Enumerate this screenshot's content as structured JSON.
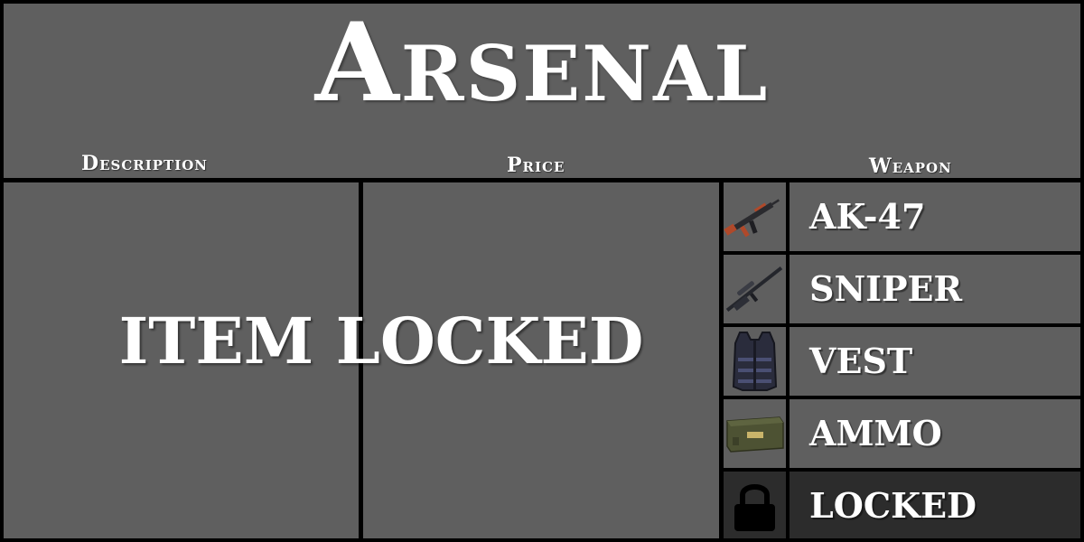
{
  "title": "Arsenal",
  "columns": {
    "description": "Description",
    "price": "Price",
    "weapon": "Weapon"
  },
  "status_text": "ITEM LOCKED",
  "weapons": [
    {
      "label": "AK-47",
      "icon": "ak47-icon"
    },
    {
      "label": "SNIPER",
      "icon": "sniper-rifle-icon"
    },
    {
      "label": "VEST",
      "icon": "body-armor-vest-icon"
    },
    {
      "label": "AMMO",
      "icon": "ammo-box-icon"
    },
    {
      "label": "LOCKED",
      "icon": "padlock-icon",
      "selected": true
    }
  ],
  "colors": {
    "panel": "#5f5f5f",
    "border": "#000000",
    "selected_row": "#2c2c2c",
    "text": "#ffffff"
  }
}
